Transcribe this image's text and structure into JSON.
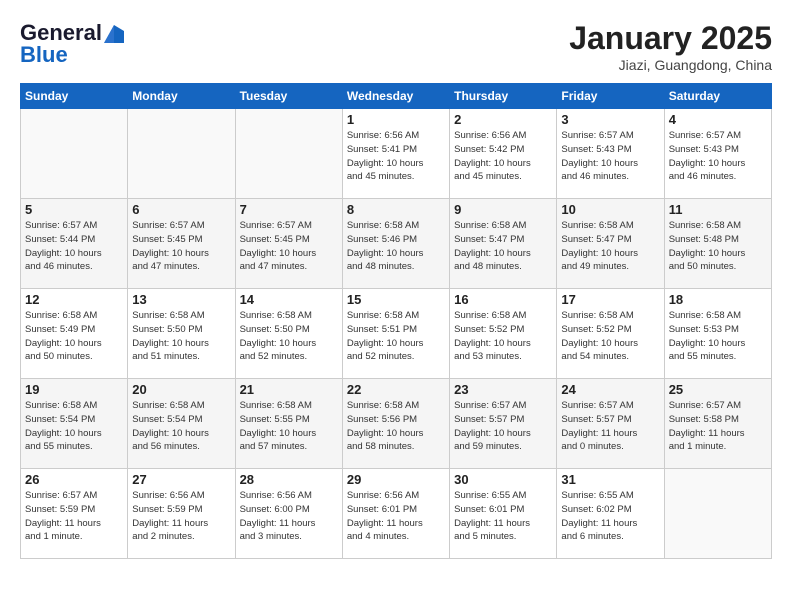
{
  "header": {
    "logo_general": "General",
    "logo_blue": "Blue",
    "title": "January 2025",
    "subtitle": "Jiazi, Guangdong, China"
  },
  "days_of_week": [
    "Sunday",
    "Monday",
    "Tuesday",
    "Wednesday",
    "Thursday",
    "Friday",
    "Saturday"
  ],
  "weeks": [
    [
      {
        "day": "",
        "info": ""
      },
      {
        "day": "",
        "info": ""
      },
      {
        "day": "",
        "info": ""
      },
      {
        "day": "1",
        "info": "Sunrise: 6:56 AM\nSunset: 5:41 PM\nDaylight: 10 hours\nand 45 minutes."
      },
      {
        "day": "2",
        "info": "Sunrise: 6:56 AM\nSunset: 5:42 PM\nDaylight: 10 hours\nand 45 minutes."
      },
      {
        "day": "3",
        "info": "Sunrise: 6:57 AM\nSunset: 5:43 PM\nDaylight: 10 hours\nand 46 minutes."
      },
      {
        "day": "4",
        "info": "Sunrise: 6:57 AM\nSunset: 5:43 PM\nDaylight: 10 hours\nand 46 minutes."
      }
    ],
    [
      {
        "day": "5",
        "info": "Sunrise: 6:57 AM\nSunset: 5:44 PM\nDaylight: 10 hours\nand 46 minutes."
      },
      {
        "day": "6",
        "info": "Sunrise: 6:57 AM\nSunset: 5:45 PM\nDaylight: 10 hours\nand 47 minutes."
      },
      {
        "day": "7",
        "info": "Sunrise: 6:57 AM\nSunset: 5:45 PM\nDaylight: 10 hours\nand 47 minutes."
      },
      {
        "day": "8",
        "info": "Sunrise: 6:58 AM\nSunset: 5:46 PM\nDaylight: 10 hours\nand 48 minutes."
      },
      {
        "day": "9",
        "info": "Sunrise: 6:58 AM\nSunset: 5:47 PM\nDaylight: 10 hours\nand 48 minutes."
      },
      {
        "day": "10",
        "info": "Sunrise: 6:58 AM\nSunset: 5:47 PM\nDaylight: 10 hours\nand 49 minutes."
      },
      {
        "day": "11",
        "info": "Sunrise: 6:58 AM\nSunset: 5:48 PM\nDaylight: 10 hours\nand 50 minutes."
      }
    ],
    [
      {
        "day": "12",
        "info": "Sunrise: 6:58 AM\nSunset: 5:49 PM\nDaylight: 10 hours\nand 50 minutes."
      },
      {
        "day": "13",
        "info": "Sunrise: 6:58 AM\nSunset: 5:50 PM\nDaylight: 10 hours\nand 51 minutes."
      },
      {
        "day": "14",
        "info": "Sunrise: 6:58 AM\nSunset: 5:50 PM\nDaylight: 10 hours\nand 52 minutes."
      },
      {
        "day": "15",
        "info": "Sunrise: 6:58 AM\nSunset: 5:51 PM\nDaylight: 10 hours\nand 52 minutes."
      },
      {
        "day": "16",
        "info": "Sunrise: 6:58 AM\nSunset: 5:52 PM\nDaylight: 10 hours\nand 53 minutes."
      },
      {
        "day": "17",
        "info": "Sunrise: 6:58 AM\nSunset: 5:52 PM\nDaylight: 10 hours\nand 54 minutes."
      },
      {
        "day": "18",
        "info": "Sunrise: 6:58 AM\nSunset: 5:53 PM\nDaylight: 10 hours\nand 55 minutes."
      }
    ],
    [
      {
        "day": "19",
        "info": "Sunrise: 6:58 AM\nSunset: 5:54 PM\nDaylight: 10 hours\nand 55 minutes."
      },
      {
        "day": "20",
        "info": "Sunrise: 6:58 AM\nSunset: 5:54 PM\nDaylight: 10 hours\nand 56 minutes."
      },
      {
        "day": "21",
        "info": "Sunrise: 6:58 AM\nSunset: 5:55 PM\nDaylight: 10 hours\nand 57 minutes."
      },
      {
        "day": "22",
        "info": "Sunrise: 6:58 AM\nSunset: 5:56 PM\nDaylight: 10 hours\nand 58 minutes."
      },
      {
        "day": "23",
        "info": "Sunrise: 6:57 AM\nSunset: 5:57 PM\nDaylight: 10 hours\nand 59 minutes."
      },
      {
        "day": "24",
        "info": "Sunrise: 6:57 AM\nSunset: 5:57 PM\nDaylight: 11 hours\nand 0 minutes."
      },
      {
        "day": "25",
        "info": "Sunrise: 6:57 AM\nSunset: 5:58 PM\nDaylight: 11 hours\nand 1 minute."
      }
    ],
    [
      {
        "day": "26",
        "info": "Sunrise: 6:57 AM\nSunset: 5:59 PM\nDaylight: 11 hours\nand 1 minute."
      },
      {
        "day": "27",
        "info": "Sunrise: 6:56 AM\nSunset: 5:59 PM\nDaylight: 11 hours\nand 2 minutes."
      },
      {
        "day": "28",
        "info": "Sunrise: 6:56 AM\nSunset: 6:00 PM\nDaylight: 11 hours\nand 3 minutes."
      },
      {
        "day": "29",
        "info": "Sunrise: 6:56 AM\nSunset: 6:01 PM\nDaylight: 11 hours\nand 4 minutes."
      },
      {
        "day": "30",
        "info": "Sunrise: 6:55 AM\nSunset: 6:01 PM\nDaylight: 11 hours\nand 5 minutes."
      },
      {
        "day": "31",
        "info": "Sunrise: 6:55 AM\nSunset: 6:02 PM\nDaylight: 11 hours\nand 6 minutes."
      },
      {
        "day": "",
        "info": ""
      }
    ]
  ]
}
